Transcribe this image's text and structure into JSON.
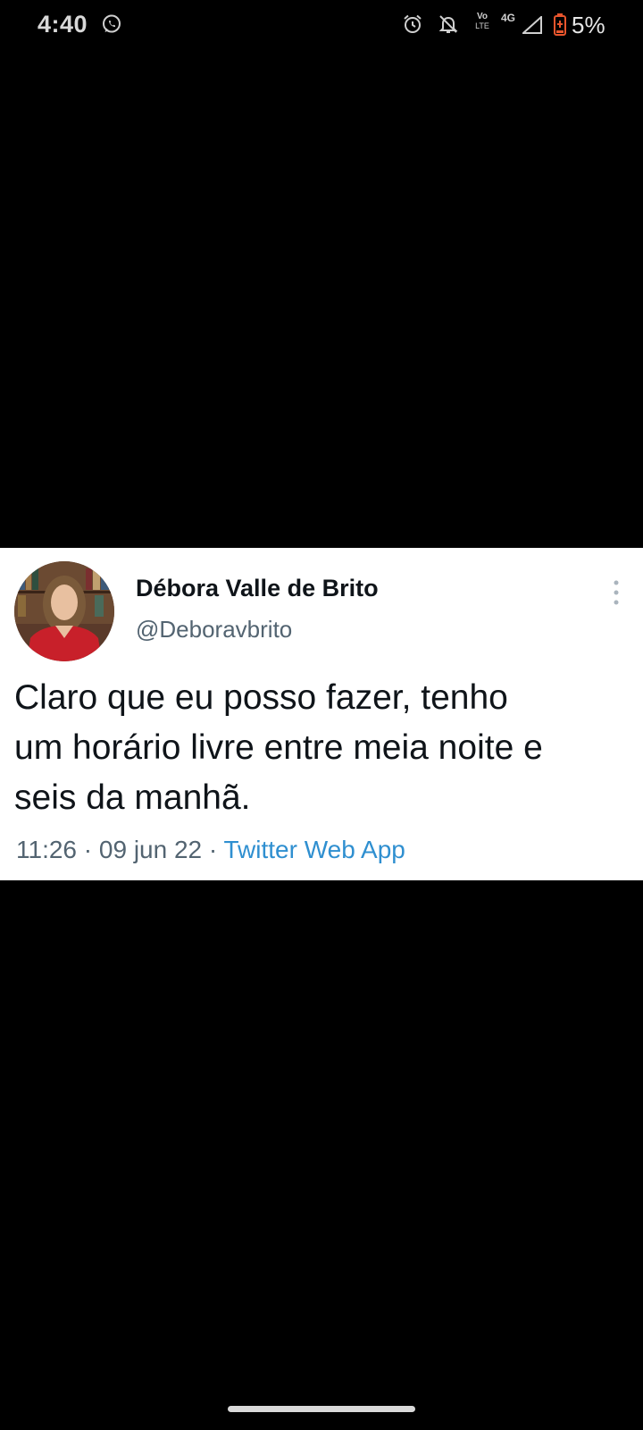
{
  "status_bar": {
    "time": "4:40",
    "network_top": "Vo",
    "network_bottom": "LTE",
    "network_type": "4G",
    "battery": "5%",
    "icons": [
      "whatsapp-icon",
      "alarm-icon",
      "muted-bell-icon",
      "volte-icon",
      "signal-icon",
      "battery-low-icon"
    ],
    "battery_color": "#e8552d"
  },
  "tweet": {
    "author_name": "Débora Valle de Brito",
    "author_handle": "@Deboravbrito",
    "text_line1": "Claro que eu posso fazer, tenho",
    "text_line2": "um horário livre entre meia noite e",
    "text_line3": "seis da manhã.",
    "time": "11:26",
    "separator": "·",
    "date": "09 jun 22",
    "source": "Twitter Web App",
    "source_color": "#2f8fd0"
  }
}
